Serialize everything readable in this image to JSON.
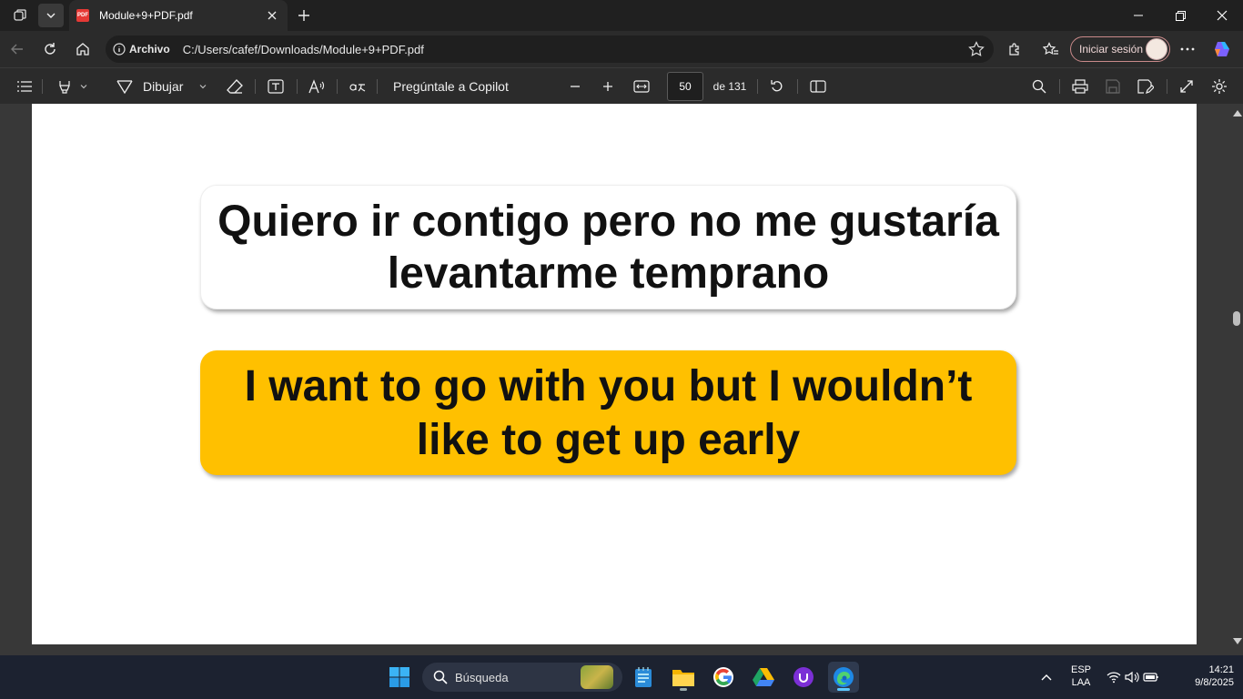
{
  "browser": {
    "tab": {
      "title": "Module+9+PDF.pdf",
      "favicon": "PDF"
    },
    "address": {
      "site_label": "Archivo",
      "url": "C:/Users/cafef/Downloads/Module+9+PDF.pdf"
    },
    "signin_label": "Iniciar sesión"
  },
  "pdf_toolbar": {
    "draw_label": "Dibujar",
    "copilot_label": "Pregúntale a Copilot",
    "page_current": "50",
    "page_total_label": "de 131"
  },
  "document": {
    "spanish_text": "Quiero ir contigo pero no me gustaría levantarme temprano",
    "english_text": "I want to go with you but I wouldn’t like to get up early",
    "highlight_color": "#ffc000"
  },
  "taskbar": {
    "search_placeholder": "Búsqueda",
    "language_line1": "ESP",
    "language_line2": "LAA",
    "time": "14:21",
    "date": "9/8/2025"
  }
}
